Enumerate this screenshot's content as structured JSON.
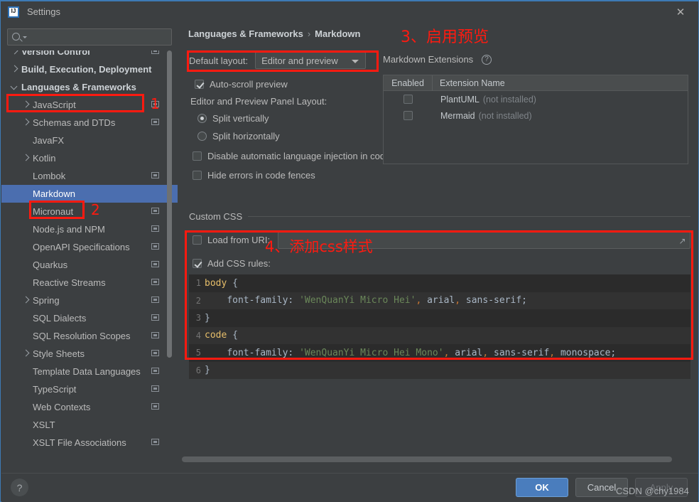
{
  "window": {
    "title": "Settings",
    "logo_icon": "intellij-idea-icon",
    "close_icon": "close-icon"
  },
  "sidebar": {
    "search": {
      "placeholder": "",
      "value": "",
      "icon": "search-icon",
      "caret_icon": "chevron-down-icon"
    },
    "items": [
      {
        "label": "Version Control",
        "level": 0,
        "arrow": "right",
        "bold": true,
        "badge": true,
        "selected": false
      },
      {
        "label": "Build, Execution, Deployment",
        "level": 0,
        "arrow": "right",
        "bold": true,
        "badge": false,
        "selected": false
      },
      {
        "label": "Languages & Frameworks",
        "level": 0,
        "arrow": "down",
        "bold": true,
        "badge": false,
        "selected": false
      },
      {
        "label": "JavaScript",
        "level": 1,
        "arrow": "right",
        "bold": false,
        "badge": true,
        "selected": false
      },
      {
        "label": "Schemas and DTDs",
        "level": 1,
        "arrow": "right",
        "bold": false,
        "badge": true,
        "selected": false
      },
      {
        "label": "JavaFX",
        "level": 1,
        "arrow": "none",
        "bold": false,
        "badge": false,
        "selected": false
      },
      {
        "label": "Kotlin",
        "level": 1,
        "arrow": "right",
        "bold": false,
        "badge": false,
        "selected": false
      },
      {
        "label": "Lombok",
        "level": 1,
        "arrow": "none",
        "bold": false,
        "badge": true,
        "selected": false
      },
      {
        "label": "Markdown",
        "level": 1,
        "arrow": "none",
        "bold": false,
        "badge": false,
        "selected": true
      },
      {
        "label": "Micronaut",
        "level": 1,
        "arrow": "none",
        "bold": false,
        "badge": true,
        "selected": false
      },
      {
        "label": "Node.js and NPM",
        "level": 1,
        "arrow": "none",
        "bold": false,
        "badge": true,
        "selected": false
      },
      {
        "label": "OpenAPI Specifications",
        "level": 1,
        "arrow": "none",
        "bold": false,
        "badge": true,
        "selected": false
      },
      {
        "label": "Quarkus",
        "level": 1,
        "arrow": "none",
        "bold": false,
        "badge": true,
        "selected": false
      },
      {
        "label": "Reactive Streams",
        "level": 1,
        "arrow": "none",
        "bold": false,
        "badge": true,
        "selected": false
      },
      {
        "label": "Spring",
        "level": 1,
        "arrow": "right",
        "bold": false,
        "badge": true,
        "selected": false
      },
      {
        "label": "SQL Dialects",
        "level": 1,
        "arrow": "none",
        "bold": false,
        "badge": true,
        "selected": false
      },
      {
        "label": "SQL Resolution Scopes",
        "level": 1,
        "arrow": "none",
        "bold": false,
        "badge": true,
        "selected": false
      },
      {
        "label": "Style Sheets",
        "level": 1,
        "arrow": "right",
        "bold": false,
        "badge": true,
        "selected": false
      },
      {
        "label": "Template Data Languages",
        "level": 1,
        "arrow": "none",
        "bold": false,
        "badge": true,
        "selected": false
      },
      {
        "label": "TypeScript",
        "level": 1,
        "arrow": "none",
        "bold": false,
        "badge": true,
        "selected": false
      },
      {
        "label": "Web Contexts",
        "level": 1,
        "arrow": "none",
        "bold": false,
        "badge": true,
        "selected": false
      },
      {
        "label": "XSLT",
        "level": 1,
        "arrow": "none",
        "bold": false,
        "badge": false,
        "selected": false
      },
      {
        "label": "XSLT File Associations",
        "level": 1,
        "arrow": "none",
        "bold": false,
        "badge": true,
        "selected": false
      }
    ]
  },
  "content": {
    "breadcrumb": {
      "parent": "Languages & Frameworks",
      "separator": "›",
      "current": "Markdown"
    },
    "default_layout": {
      "label": "Default layout:",
      "value": "Editor and preview",
      "arrow_icon": "chevron-down-icon"
    },
    "auto_scroll": {
      "label": "Auto-scroll preview",
      "checked": true
    },
    "panel_layout_label": "Editor and Preview Panel Layout:",
    "radios": [
      {
        "label": "Split vertically",
        "selected": true
      },
      {
        "label": "Split horizontally",
        "selected": false
      }
    ],
    "checkboxes": [
      {
        "label": "Disable automatic language injection in code fences",
        "checked": false
      },
      {
        "label": "Hide errors in code fences",
        "checked": false
      }
    ],
    "extensions": {
      "title": "Markdown Extensions",
      "help_icon": "help-circle-icon",
      "columns": [
        "Enabled",
        "Extension Name"
      ],
      "rows": [
        {
          "enabled": false,
          "name": "PlantUML",
          "status": "(not installed)"
        },
        {
          "enabled": false,
          "name": "Mermaid",
          "status": "(not installed)"
        }
      ]
    },
    "custom_css": {
      "group_title": "Custom CSS",
      "load_from_uri": {
        "label": "Load from URI:",
        "checked": false,
        "value": "",
        "browse_icon": "browse-icon"
      },
      "add_css_rules": {
        "label": "Add CSS rules:",
        "checked": true
      },
      "code_lines": [
        {
          "num": "1",
          "segments": [
            {
              "t": "body ",
              "c": "tok-sel"
            },
            {
              "t": "{",
              "c": "tok-plain"
            }
          ]
        },
        {
          "num": "2",
          "segments": [
            {
              "t": "    ",
              "c": "tok-plain"
            },
            {
              "t": "font-family",
              "c": "tok-plain"
            },
            {
              "t": ": ",
              "c": "tok-plain"
            },
            {
              "t": "'WenQuanYi Micro Hei'",
              "c": "tok-str"
            },
            {
              "t": ", ",
              "c": "tok-punc"
            },
            {
              "t": "arial",
              "c": "tok-plain"
            },
            {
              "t": ", ",
              "c": "tok-punc"
            },
            {
              "t": "sans-serif",
              "c": "tok-plain"
            },
            {
              "t": ";",
              "c": "tok-plain"
            }
          ]
        },
        {
          "num": "3",
          "segments": [
            {
              "t": "}",
              "c": "tok-plain"
            }
          ]
        },
        {
          "num": "4",
          "segments": [
            {
              "t": "code ",
              "c": "tok-sel"
            },
            {
              "t": "{",
              "c": "tok-plain"
            }
          ]
        },
        {
          "num": "5",
          "segments": [
            {
              "t": "    ",
              "c": "tok-plain"
            },
            {
              "t": "font-family",
              "c": "tok-plain"
            },
            {
              "t": ": ",
              "c": "tok-plain"
            },
            {
              "t": "'WenQuanYi Micro Hei Mono'",
              "c": "tok-str"
            },
            {
              "t": ", ",
              "c": "tok-punc"
            },
            {
              "t": "arial",
              "c": "tok-plain"
            },
            {
              "t": ", ",
              "c": "tok-punc"
            },
            {
              "t": "sans-serif",
              "c": "tok-plain"
            },
            {
              "t": ", ",
              "c": "tok-punc"
            },
            {
              "t": "monospace",
              "c": "tok-plain"
            },
            {
              "t": ";",
              "c": "tok-plain"
            }
          ]
        },
        {
          "num": "6",
          "segments": [
            {
              "t": "}",
              "c": "tok-plain"
            }
          ]
        }
      ]
    }
  },
  "footer": {
    "help_label": "?",
    "ok_label": "OK",
    "cancel_label": "Cancel",
    "apply_label": "Apply",
    "watermark": "CSDN @chy1984"
  },
  "annotations": {
    "color": "#ff1a10",
    "markers": [
      {
        "id": "1",
        "text": "1"
      },
      {
        "id": "2",
        "text": "2"
      },
      {
        "id": "3",
        "text": "3、启用预览"
      },
      {
        "id": "4",
        "text": "4、添加css样式"
      }
    ]
  }
}
